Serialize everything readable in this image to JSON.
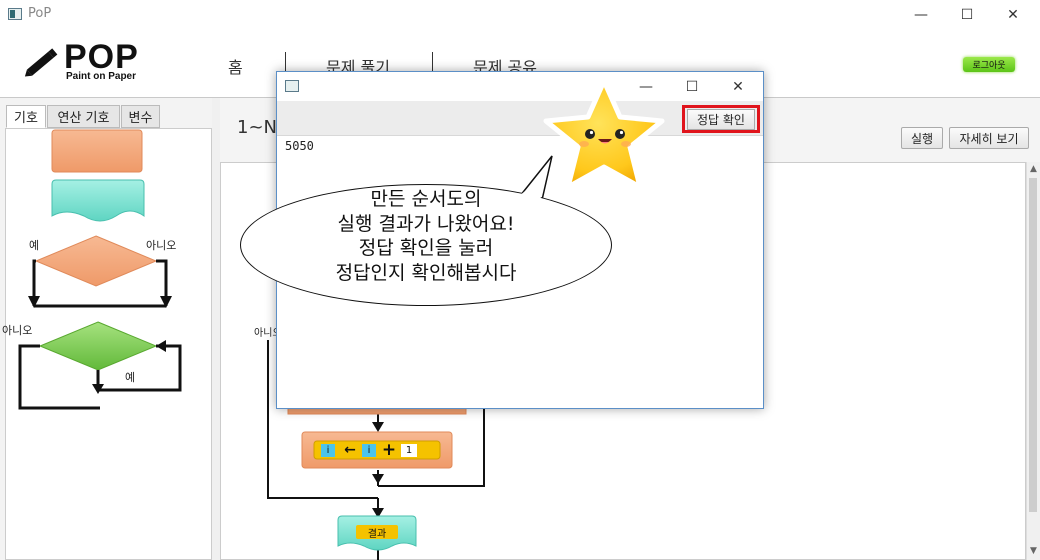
{
  "window": {
    "title": "PoP",
    "controls": {
      "minimize": "—",
      "maximize": "☐",
      "close": "✕"
    }
  },
  "header": {
    "logo_text": "POP",
    "logo_sub": "Paint on Paper",
    "nav": [
      "홈",
      "문제 풀기",
      "문제 공유"
    ],
    "logout_label": "로그아웃"
  },
  "left_panel": {
    "tabs": [
      "기호",
      "연산 기호",
      "변수"
    ],
    "branch_yes": "예",
    "branch_no": "아니오",
    "loop_no": "아니오",
    "loop_yes": "예"
  },
  "main": {
    "problem_title": "1~N",
    "run_label": "실행",
    "detail_label": "자세히 보기",
    "canvas_loop_no": "아니오",
    "assign_block": {
      "var1": "i",
      "op_arrow": "←",
      "var2": "i",
      "op_plus": "+",
      "num": "1"
    },
    "result_block_label": "결과"
  },
  "dialog": {
    "controls": {
      "minimize": "—",
      "maximize": "☐",
      "close": "✕"
    },
    "check_label": "정답 확인",
    "output": "5050"
  },
  "speech_bubble": {
    "lines": [
      "만든 순서도의",
      "실행 결과가 나왔어요!",
      "정답 확인을 눌러",
      "정답인지 확인해봅시다"
    ]
  },
  "colors": {
    "accent_red": "#e0141c",
    "logout_green": "#6cd21f",
    "process_orange": "#f2a57a",
    "io_teal": "#7fe3d2",
    "decision_green": "#7dcc4f"
  }
}
